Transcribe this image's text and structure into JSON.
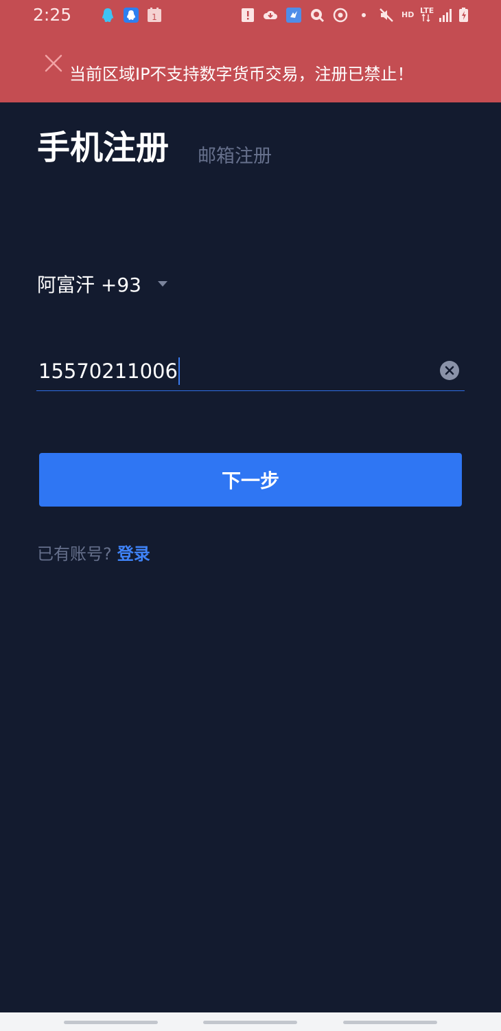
{
  "status_bar": {
    "time": "2:25",
    "network_label": "HD",
    "lte_label": "LTE"
  },
  "banner": {
    "message": "当前区域IP不支持数字货币交易，注册已禁止！"
  },
  "tabs": {
    "phone": "手机注册",
    "email": "邮箱注册"
  },
  "country": {
    "label": "阿富汗 +93"
  },
  "phone_input": {
    "value": "15570211006"
  },
  "next_button": {
    "label": "下一步"
  },
  "login": {
    "prompt": "已有账号?",
    "link": "登录"
  },
  "colors": {
    "banner": "#c44d52",
    "background": "#131b2f",
    "accent": "#2f76f3",
    "muted": "#66708c"
  }
}
